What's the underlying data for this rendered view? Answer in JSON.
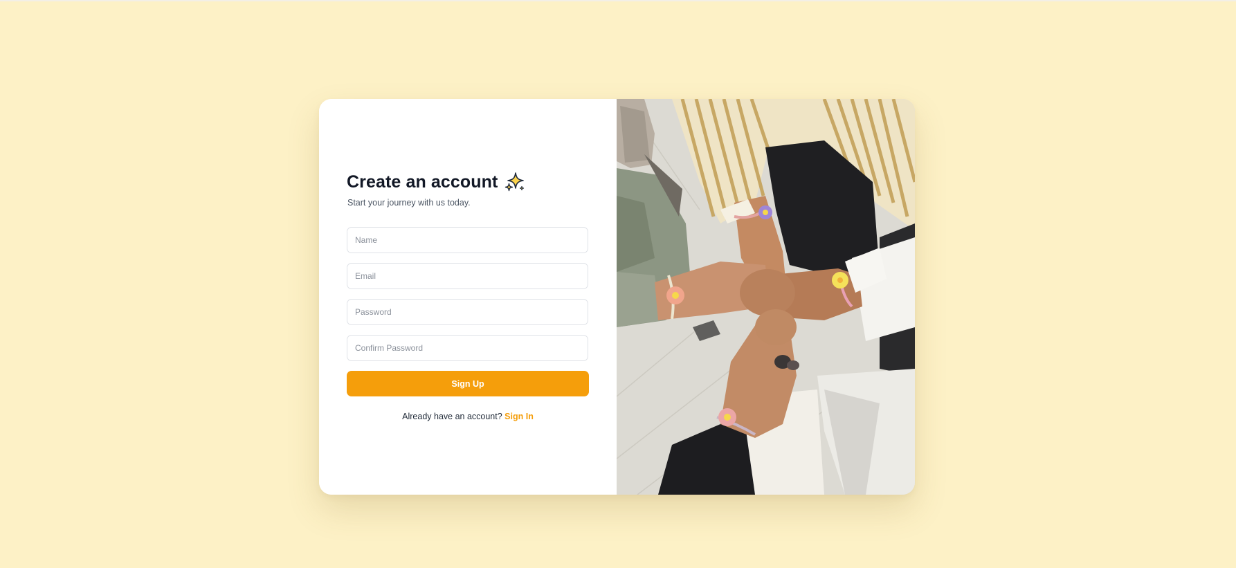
{
  "signup": {
    "title": "Create an account",
    "title_icon": "sparkles-icon",
    "subtitle": "Start your journey with us today.",
    "fields": {
      "name_placeholder": "Name",
      "email_placeholder": "Email",
      "password_placeholder": "Password",
      "confirm_password_placeholder": "Confirm Password"
    },
    "submit_label": "Sign Up",
    "signin_prompt": "Already have an account?",
    "signin_link": "Sign In"
  },
  "colors": {
    "page_background": "#fdf1c6",
    "accent": "#f59e0b",
    "card_background": "#ffffff",
    "heading": "#121826"
  },
  "hero_image": {
    "subject": "five hands joined in a fist bump wearing daisy bracelets"
  }
}
